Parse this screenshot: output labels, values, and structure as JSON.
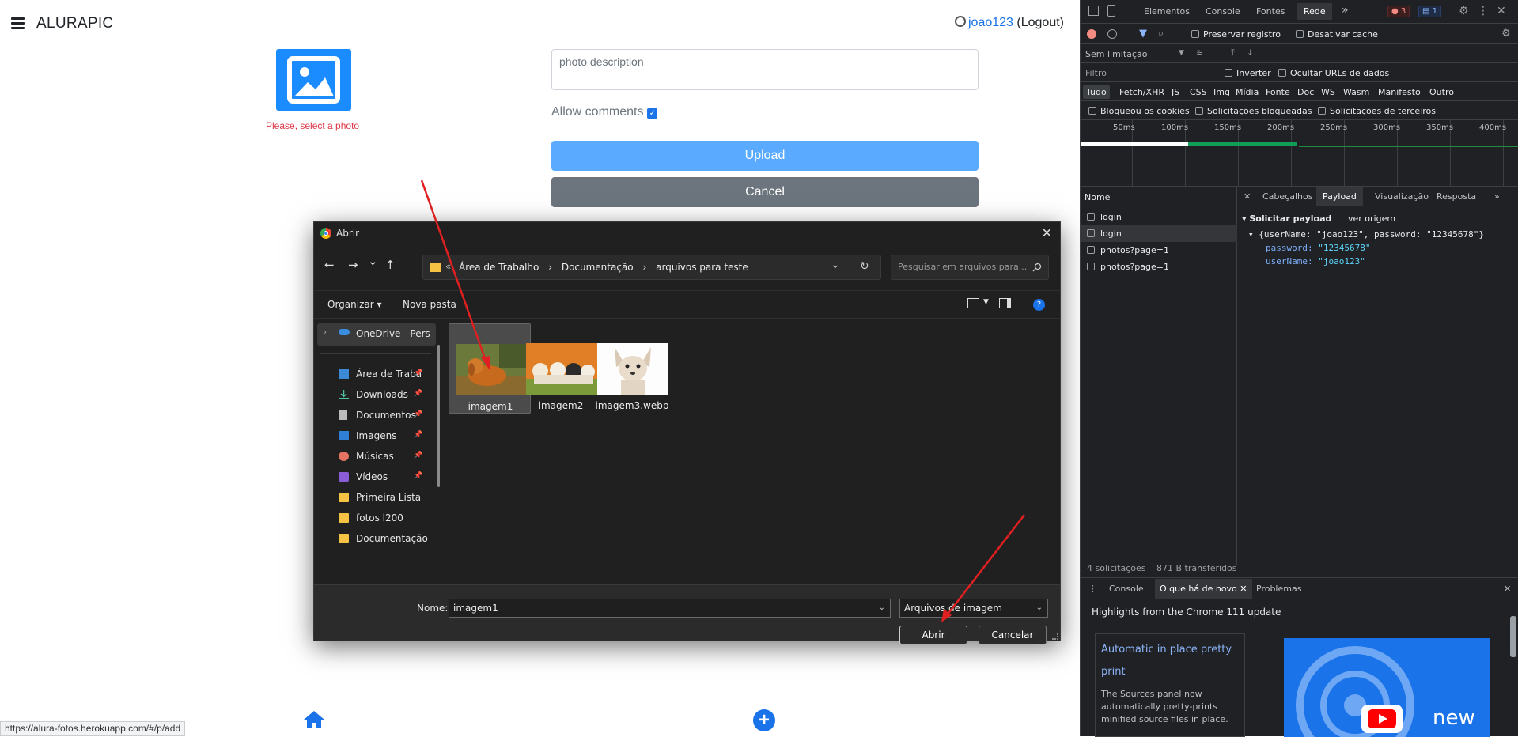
{
  "app": {
    "brand": "ALURAPIC",
    "user_name": "joao123",
    "logout": "(Logout)",
    "select_photo_msg": "Please, select a photo",
    "description_placeholder": "photo description",
    "allow_comments_label": "Allow comments",
    "allow_comments_checked": true,
    "upload_label": "Upload",
    "cancel_label": "Cancel",
    "status_url": "https://alura-fotos.herokuapp.com/#/p/add",
    "accent_color": "#1a73e8",
    "error_color": "#dc3545"
  },
  "dialog": {
    "title": "Abrir",
    "close": "✕",
    "nav": {
      "back": "←",
      "forward": "→",
      "dropdown": "⌄",
      "up": "↑",
      "recent": "⌄",
      "refresh": "↻"
    },
    "breadcrumb": {
      "overflow": "«",
      "parts": [
        "Área de Trabalho",
        "Documentação",
        "arquivos para teste"
      ],
      "sep": "›"
    },
    "search_placeholder": "Pesquisar em arquivos para...",
    "toolbar": {
      "organize": "Organizar ▾",
      "new_folder": "Nova pasta",
      "help": "?"
    },
    "sidebar": [
      {
        "label": "OneDrive - Pers",
        "icon": "cloud-icon",
        "pinned": false,
        "selected": true
      },
      {
        "label": "Área de Traba",
        "icon": "desktop-icon",
        "pinned": true
      },
      {
        "label": "Downloads",
        "icon": "download-icon",
        "pinned": true
      },
      {
        "label": "Documentos",
        "icon": "document-icon",
        "pinned": true
      },
      {
        "label": "Imagens",
        "icon": "image-icon",
        "pinned": true
      },
      {
        "label": "Músicas",
        "icon": "music-icon",
        "pinned": true
      },
      {
        "label": "Vídeos",
        "icon": "video-icon",
        "pinned": true
      },
      {
        "label": "Primeira Lista",
        "icon": "folder-icon",
        "pinned": false
      },
      {
        "label": "fotos l200",
        "icon": "folder-icon",
        "pinned": false
      },
      {
        "label": "Documentação",
        "icon": "folder-icon",
        "pinned": false
      }
    ],
    "pin_glyph": "📌",
    "files": [
      {
        "name": "imagem1",
        "thumb": "golden-dog",
        "selected": true
      },
      {
        "name": "imagem2",
        "thumb": "puppies",
        "selected": false
      },
      {
        "name": "imagem3.webp",
        "thumb": "chihuahua",
        "selected": false
      }
    ],
    "filename_label": "Nome:",
    "filename_value": "imagem1",
    "filetype_value": "Arquivos de imagem",
    "open_label": "Abrir",
    "cancel_label": "Cancelar"
  },
  "devtools": {
    "tabs": [
      "Elementos",
      "Console",
      "Fontes",
      "Rede"
    ],
    "active_tab": "Rede",
    "more": "»",
    "errors": "3",
    "messages": "1",
    "preserve_log": "Preservar registro",
    "disable_cache": "Desativar cache",
    "throttling": "Sem limitação",
    "filter_placeholder": "Filtro",
    "invert": "Inverter",
    "hide_data_urls": "Ocultar URLs de dados",
    "type_filters": [
      "Tudo",
      "Fetch/XHR",
      "JS",
      "CSS",
      "Img",
      "Mídia",
      "Fonte",
      "Doc",
      "WS",
      "Wasm",
      "Manifesto",
      "Outro"
    ],
    "blocked_cookies": "Bloqueou os cookies",
    "blocked_requests": "Solicitações bloqueadas",
    "third_party": "Solicitações de terceiros",
    "timeline_ticks": [
      "50ms",
      "100ms",
      "150ms",
      "200ms",
      "250ms",
      "300ms",
      "350ms",
      "400ms"
    ],
    "name_header": "Nome",
    "requests": [
      "login",
      "login",
      "photos?page=1",
      "photos?page=1"
    ],
    "selected_request": 1,
    "detail_tabs": [
      "Cabeçalhos",
      "Payload",
      "Visualização",
      "Resposta"
    ],
    "detail_active": "Payload",
    "payload_title": "Solicitar payload",
    "view_source": "ver origem",
    "payload_summary": "{userName: \"joao123\", password: \"12345678\"}",
    "payload_password_key": "password:",
    "payload_password": "\"12345678\"",
    "payload_username_key": "userName:",
    "payload_username": "\"joao123\"",
    "footer_requests": "4 solicitações",
    "footer_transferred": "871 B transferidos",
    "drawer_tabs": [
      "Console",
      "O que há de novo",
      "Problemas"
    ],
    "drawer_active": "O que há de novo",
    "whatsnew_heading": "Highlights from the Chrome 111 update",
    "card_title_1": "Automatic in place pretty",
    "card_title_2": "print",
    "card_text": "The Sources panel now automatically pretty-prints minified source files in place.",
    "video_text": "new"
  }
}
